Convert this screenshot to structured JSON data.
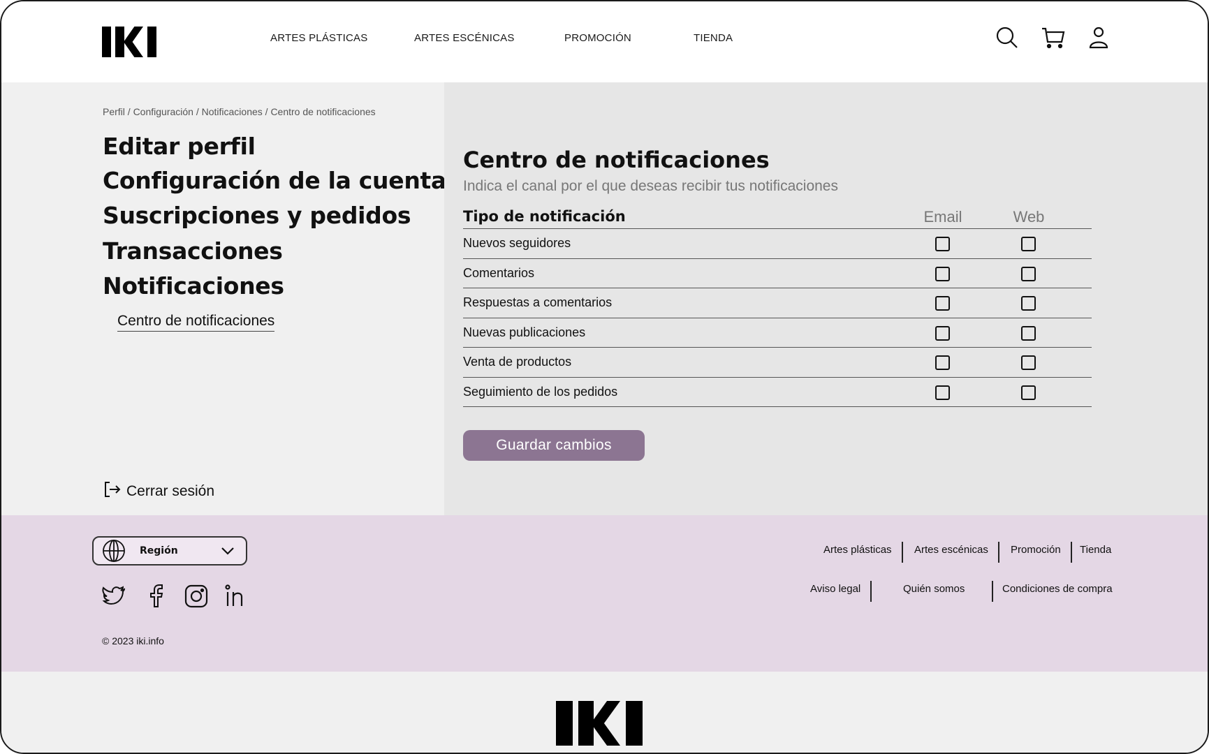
{
  "header": {
    "brand": "IKI",
    "nav": [
      "ARTES PLÁSTICAS",
      "ARTES ESCÉNICAS",
      "PROMOCIÓN",
      "TIENDA"
    ],
    "icons": [
      "search-icon",
      "cart-icon",
      "user-icon"
    ]
  },
  "sidebar": {
    "breadcrumb": "Perfil / Configuración / Notificaciones / Centro de notificaciones",
    "items": [
      "Editar perfil",
      "Configuración de la cuenta",
      "Suscripciones y pedidos",
      "Transacciones",
      "Notificaciones"
    ],
    "subitem": "Centro de notificaciones",
    "logout": "Cerrar sesión"
  },
  "main": {
    "title": "Centro de notificaciones",
    "subtitle": "Indica el canal por el que deseas recibir tus notificaciones",
    "table": {
      "headers": [
        "Tipo de notificación",
        "Email",
        "Web"
      ],
      "rows": [
        {
          "label": "Nuevos seguidores",
          "email": false,
          "web": false
        },
        {
          "label": "Comentarios",
          "email": false,
          "web": false
        },
        {
          "label": "Respuestas a comentarios",
          "email": false,
          "web": false
        },
        {
          "label": "Nuevas publicaciones",
          "email": false,
          "web": false
        },
        {
          "label": "Venta de productos",
          "email": false,
          "web": false
        },
        {
          "label": "Seguimiento de los pedidos",
          "email": false,
          "web": false
        }
      ]
    },
    "save_label": "Guardar cambios"
  },
  "footer": {
    "region_label": "Región",
    "social": [
      "twitter-icon",
      "facebook-icon",
      "instagram-icon",
      "linkedin-icon"
    ],
    "copyright": "© 2023 iki.info",
    "links_top": [
      "Artes plásticas",
      "Artes escénicas",
      "Promoción",
      "Tienda"
    ],
    "links_bottom": [
      "Aviso legal",
      "Quién somos",
      "Condiciones de compra"
    ]
  },
  "colors": {
    "accent_button": "#8c7592",
    "footer_bg": "#e4d7e5",
    "main_bg": "#e6e6e6",
    "sidebar_bg": "#f0f0f0"
  }
}
